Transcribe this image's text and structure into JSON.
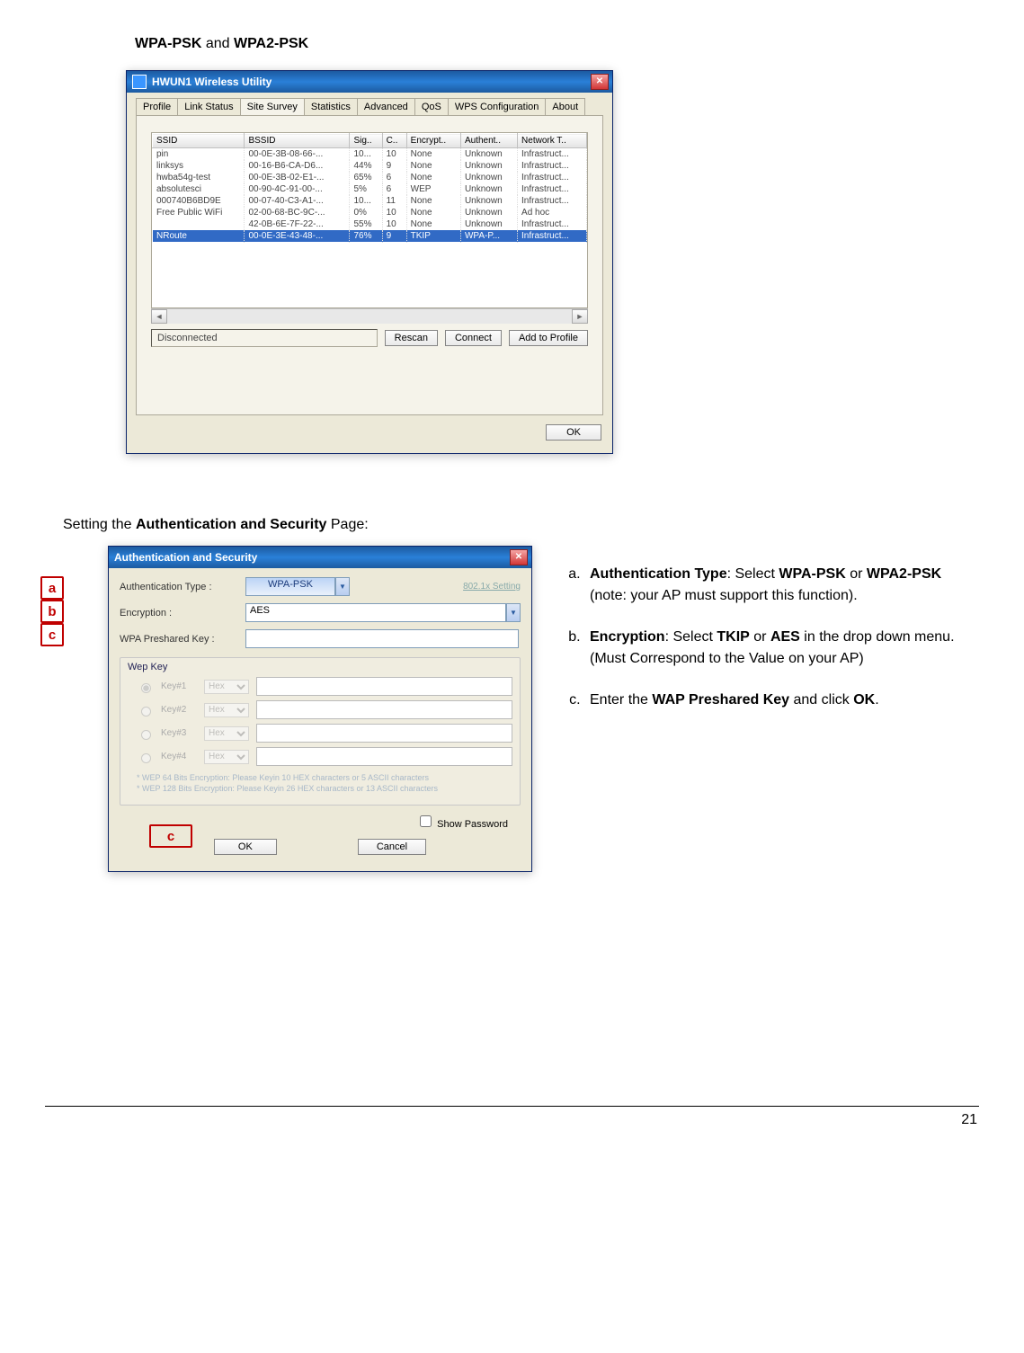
{
  "heading1_pre": "WPA-PSK",
  "heading1_mid": " and ",
  "heading1_post": "WPA2-PSK",
  "win1": {
    "title": "HWUN1 Wireless Utility",
    "tabs": [
      "Profile",
      "Link Status",
      "Site Survey",
      "Statistics",
      "Advanced",
      "QoS",
      "WPS Configuration",
      "About"
    ],
    "headers": [
      "SSID",
      "BSSID",
      "Sig..",
      "C..",
      "Encrypt..",
      "Authent..",
      "Network T.."
    ],
    "rows": [
      [
        "pin",
        "00-0E-3B-08-66-...",
        "10...",
        "10",
        "None",
        "Unknown",
        "Infrastruct..."
      ],
      [
        "linksys",
        "00-16-B6-CA-D6...",
        "44%",
        "9",
        "None",
        "Unknown",
        "Infrastruct..."
      ],
      [
        "hwba54g-test",
        "00-0E-3B-02-E1-...",
        "65%",
        "6",
        "None",
        "Unknown",
        "Infrastruct..."
      ],
      [
        "absolutesci",
        "00-90-4C-91-00-...",
        "5%",
        "6",
        "WEP",
        "Unknown",
        "Infrastruct..."
      ],
      [
        "000740B6BD9E",
        "00-07-40-C3-A1-...",
        "10...",
        "11",
        "None",
        "Unknown",
        "Infrastruct..."
      ],
      [
        "Free Public WiFi",
        "02-00-68-BC-9C-...",
        "0%",
        "10",
        "None",
        "Unknown",
        "Ad hoc"
      ],
      [
        "",
        "42-0B-6E-7F-22-...",
        "55%",
        "10",
        "None",
        "Unknown",
        "Infrastruct..."
      ],
      [
        "NRoute",
        "00-0E-3E-43-48-...",
        "76%",
        "9",
        "TKIP",
        "WPA-P...",
        "Infrastruct..."
      ]
    ],
    "status": "Disconnected",
    "btn_rescan": "Rescan",
    "btn_connect": "Connect",
    "btn_add": "Add to Profile",
    "ok": "OK"
  },
  "heading2_pre": "Setting the ",
  "heading2_bold": "Authentication and Security",
  "heading2_post": " Page:",
  "win2": {
    "title": "Authentication and Security",
    "auth_label": "Authentication Type :",
    "auth_value": "WPA-PSK",
    "right_link": "802.1x Setting",
    "enc_label": "Encryption :",
    "enc_value": "AES",
    "wpa_label": "WPA Preshared Key :",
    "wep_title": "Wep Key",
    "keylabels": [
      "Key#1",
      "Key#2",
      "Key#3",
      "Key#4"
    ],
    "keyfmt": "Hex",
    "note1": "* WEP 64 Bits Encryption: Please Keyin 10 HEX characters or 5 ASCII characters",
    "note2": "* WEP 128 Bits Encryption: Please Keyin 26 HEX characters or 13 ASCII characters",
    "showpw": "Show Password",
    "ok": "OK",
    "cancel": "Cancel"
  },
  "instr": {
    "a1": "Authentication Type",
    "a2": ": Select ",
    "a3": "WPA-PSK",
    "a4": " or ",
    "a5": "WPA2-PSK",
    "a6": " (note: your AP must support this function).",
    "b1": "Encryption",
    "b2": ": Select ",
    "b3": "TKIP",
    "b4": " or ",
    "b5": "AES",
    "b6": " in the drop down menu.(Must Correspond to the Value on your AP)",
    "c1": "Enter the ",
    "c2": "WAP Preshared Key",
    "c3": " and click ",
    "c4": "OK",
    "c5": "."
  },
  "page_number": "21"
}
